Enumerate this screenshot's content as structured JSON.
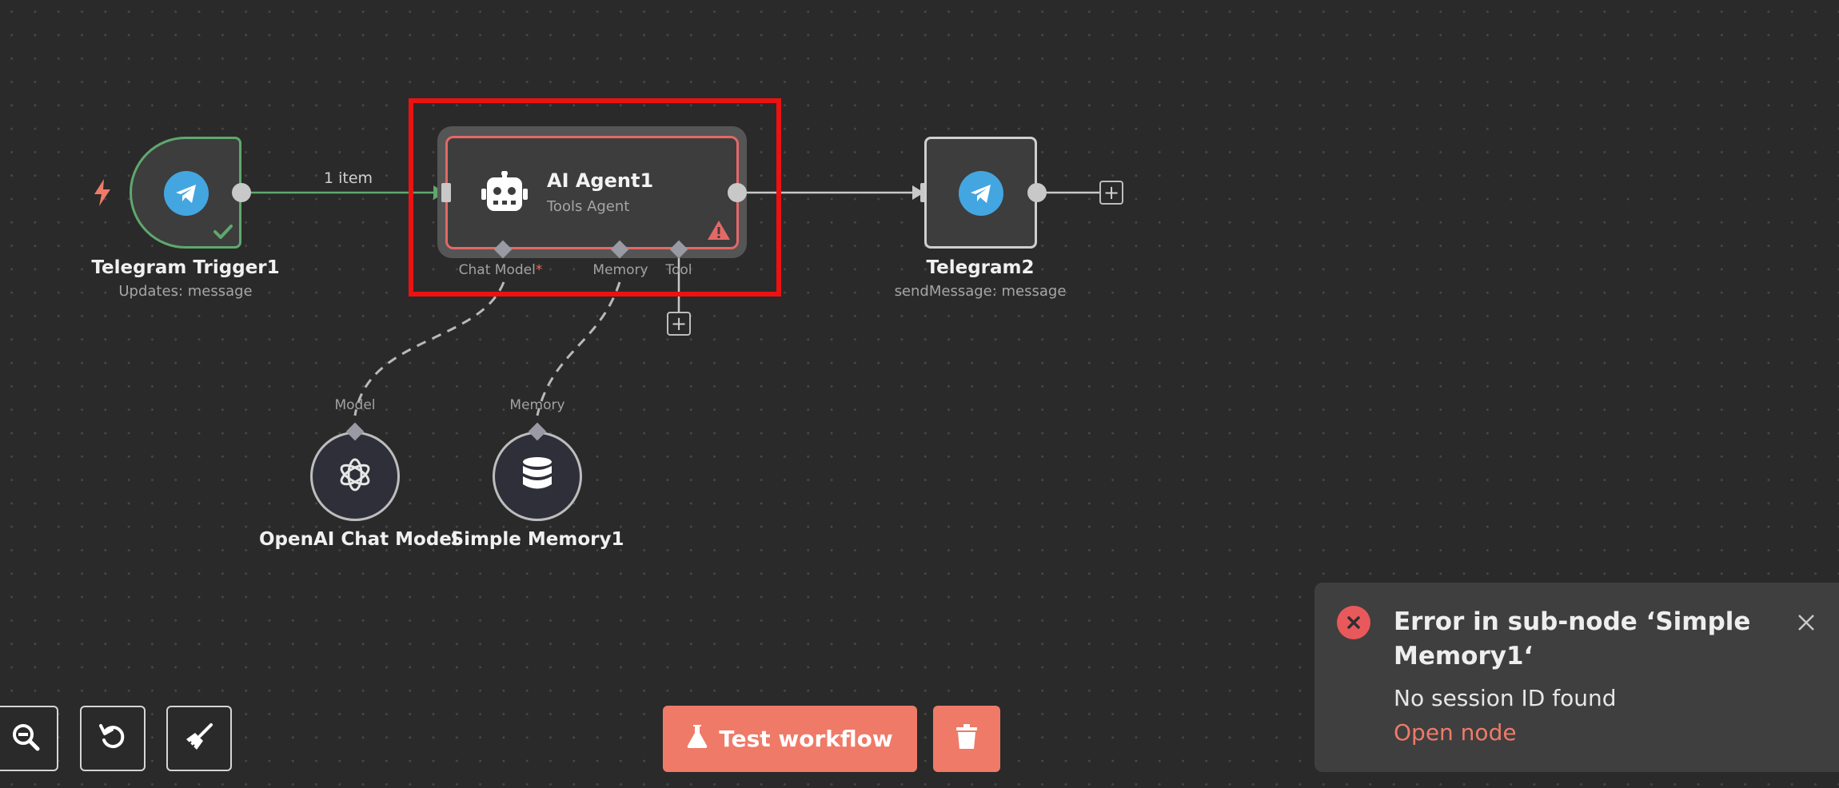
{
  "canvas": {
    "edge_label": "1 item",
    "nodes": {
      "trigger": {
        "title": "Telegram Trigger1",
        "subtitle": "Updates: message",
        "icon": "telegram-icon",
        "status_icon": "check-icon",
        "trigger_icon": "lightning-icon"
      },
      "agent": {
        "title": "AI Agent1",
        "subtitle": "Tools Agent",
        "icon": "robot-icon",
        "warning_icon": "warning-icon"
      },
      "telegram2": {
        "title": "Telegram2",
        "subtitle": "sendMessage: message",
        "icon": "telegram-icon"
      },
      "openai": {
        "title": "OpenAI Chat Model",
        "port_label": "Model",
        "icon": "openai-icon"
      },
      "memory": {
        "title": "Simple Memory1",
        "port_label": "Memory",
        "icon": "database-icon"
      }
    },
    "agent_ports": {
      "chat_model": "Chat Model",
      "required_marker": "*",
      "memory": "Memory",
      "tool": "Tool"
    },
    "add_symbol": "+"
  },
  "controls": {
    "zoom_out_icon": "zoom-out-icon",
    "reset_icon": "undo-icon",
    "tidy_icon": "broom-icon"
  },
  "actions": {
    "test_workflow_label": "Test workflow",
    "test_icon": "flask-icon",
    "delete_icon": "trash-icon"
  },
  "toast": {
    "title": "Error in sub-node ‘Simple Memory1‘",
    "message": "No session ID found",
    "link": "Open node",
    "close_icon": "close-icon",
    "error_icon": "error-x-icon"
  },
  "colors": {
    "canvas_bg": "#2a2a2a",
    "success_green": "#5fa86e",
    "error_red": "#e36967",
    "accent_orange": "#ef7a68",
    "telegram_blue": "#43a6e1",
    "selection_red": "#ee1111"
  }
}
